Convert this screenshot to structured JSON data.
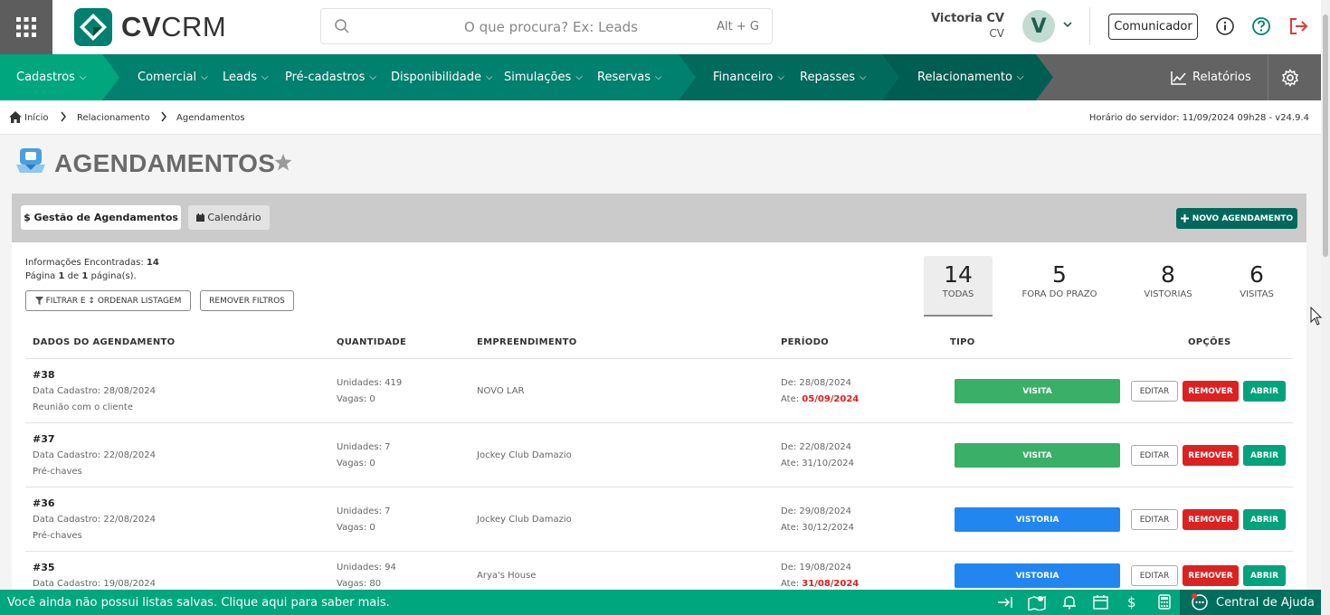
{
  "header": {
    "logo_text_bold": "CV",
    "logo_text_light": "CRM",
    "search_placeholder": "O que procura? Ex: Leads",
    "search_shortcut": "Alt + G",
    "user_name": "Victoria CV",
    "user_sub": "CV",
    "avatar_letter": "V",
    "comunicador_label": "Comunicador"
  },
  "nav": {
    "items": [
      {
        "label": "Cadastros"
      },
      {
        "label": "Comercial"
      },
      {
        "label": "Leads"
      },
      {
        "label": "Pré-cadastros"
      },
      {
        "label": "Disponibilidade"
      },
      {
        "label": "Simulações"
      },
      {
        "label": "Reservas"
      },
      {
        "label": "Financeiro"
      },
      {
        "label": "Repasses"
      },
      {
        "label": "Relacionamento"
      }
    ],
    "relatorios_label": "Relatórios"
  },
  "breadcrumb": {
    "items": [
      "Início",
      "Relacionamento",
      "Agendamentos"
    ],
    "server_time": "Horário do servidor: 11/09/2024 09h28 - v24.9.4"
  },
  "page": {
    "title": "AGENDAMENTOS"
  },
  "tabs": {
    "gestao_label": "$ Gestão de Agendamentos",
    "calendario_label": "Calendário",
    "novo_label": "NOVO AGENDAMENTO"
  },
  "info": {
    "found_label": "Informações Encontradas:",
    "found_value": "14",
    "page_word": "Página",
    "page_current": "1",
    "page_of": "de",
    "page_total": "1",
    "page_suffix": "página(s).",
    "filter_label": "FILTRAR E ↕ ORDENAR LISTAGEM",
    "remove_filters_label": "REMOVER FILTROS"
  },
  "stats": [
    {
      "value": "14",
      "label": "TODAS"
    },
    {
      "value": "5",
      "label": "FORA DO PRAZO"
    },
    {
      "value": "8",
      "label": "VISTORIAS"
    },
    {
      "value": "6",
      "label": "VISITAS"
    }
  ],
  "table": {
    "headers": [
      "DADOS DO AGENDAMENTO",
      "QUANTIDADE",
      "EMPREENDIMENTO",
      "PERÍODO",
      "TIPO",
      "OPÇÕES"
    ],
    "rows": [
      {
        "id": "#38",
        "cadastro": "Data Cadastro: 28/08/2024",
        "desc": "Reunião com o cliente",
        "unidades": "Unidades: 419",
        "vagas": "Vagas: 0",
        "empreendimento": "NOVO LAR",
        "de": "De: 28/08/2024",
        "ate_label": "Ate:",
        "ate_date": "05/09/2024",
        "ate_overdue": true,
        "tipo": "VISITA",
        "tipo_color": "#3aaf68"
      },
      {
        "id": "#37",
        "cadastro": "Data Cadastro: 22/08/2024",
        "desc": "Pré-chaves",
        "unidades": "Unidades: 7",
        "vagas": "Vagas: 0",
        "empreendimento": "Jockey Club Damazio",
        "de": "De: 22/08/2024",
        "ate_label": "Ate:",
        "ate_date": "31/10/2024",
        "ate_overdue": false,
        "tipo": "VISITA",
        "tipo_color": "#3aaf68"
      },
      {
        "id": "#36",
        "cadastro": "Data Cadastro: 22/08/2024",
        "desc": "Pré-chaves",
        "unidades": "Unidades: 7",
        "vagas": "Vagas: 0",
        "empreendimento": "Jockey Club Damazio",
        "de": "De: 29/08/2024",
        "ate_label": "Ate:",
        "ate_date": "30/12/2024",
        "ate_overdue": false,
        "tipo": "VISTORIA",
        "tipo_color": "#2186f0"
      },
      {
        "id": "#35",
        "cadastro": "Data Cadastro: 19/08/2024",
        "desc": "",
        "unidades": "Unidades: 94",
        "vagas": "Vagas: 80",
        "empreendimento": "Arya's House",
        "de": "De: 19/08/2024",
        "ate_label": "Ate:",
        "ate_date": "31/08/2024",
        "ate_overdue": true,
        "tipo": "VISTORIA",
        "tipo_color": "#2186f0"
      }
    ],
    "edit_label": "EDITAR",
    "remove_label": "REMOVER",
    "open_label": "ABRIR"
  },
  "footer": {
    "message": "Você ainda não possui listas salvas. Clique aqui para saber mais.",
    "help_label": "Central de Ajuda"
  },
  "colors": {
    "nav_green": "#00806f",
    "nav_light": "#00a67e",
    "nav_dark": "#006a5d",
    "visita": "#3aaf68",
    "vistoria": "#2186f0",
    "remove": "#dc2121",
    "open": "#00a37c"
  }
}
